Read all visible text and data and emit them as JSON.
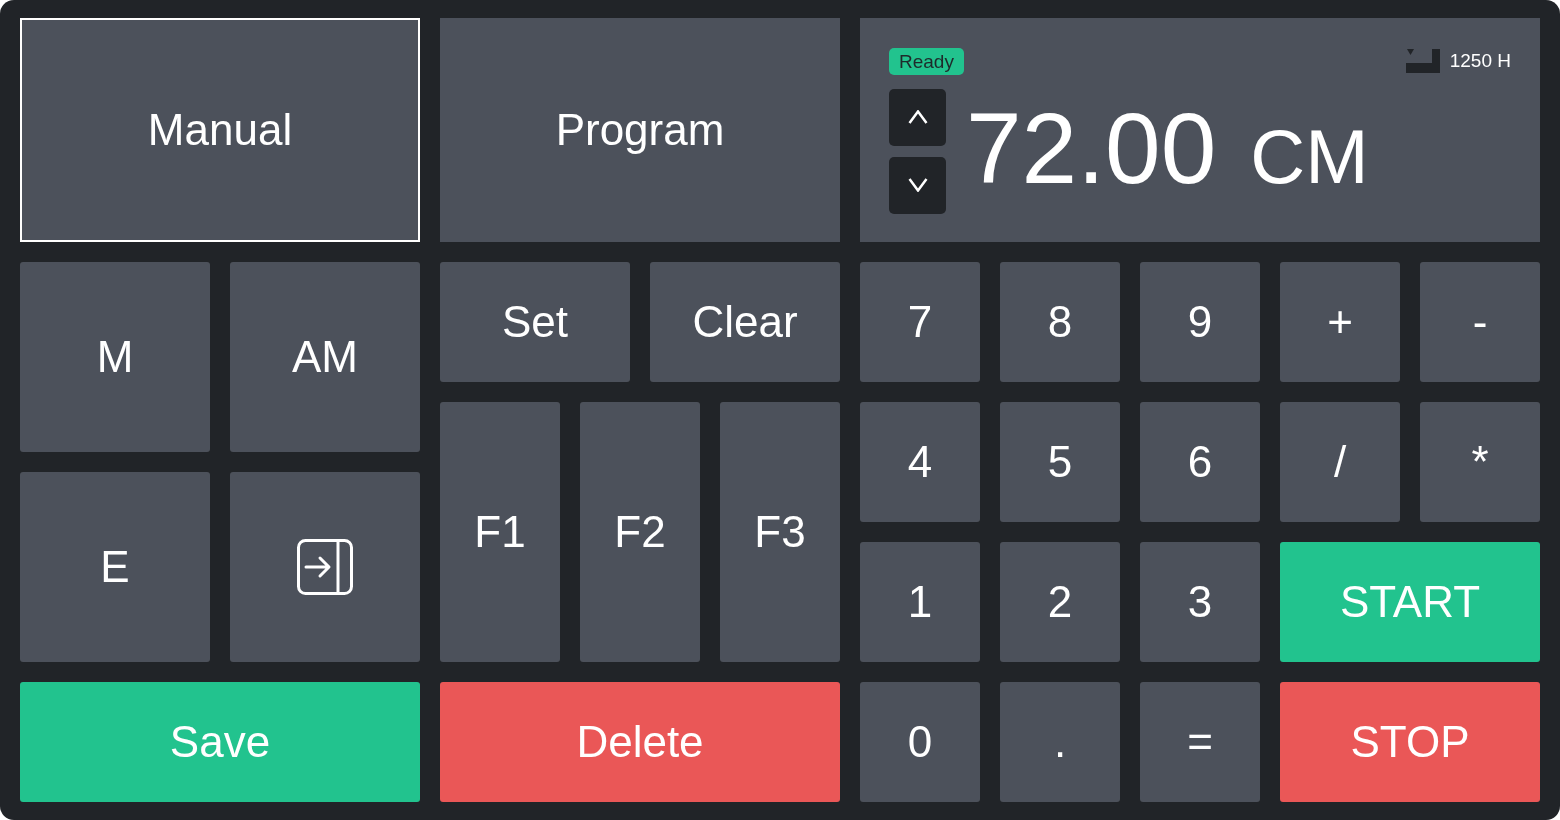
{
  "mode_tabs": [
    {
      "label": "Manual",
      "selected": true
    },
    {
      "label": "Program",
      "selected": false
    }
  ],
  "display": {
    "status": "Ready",
    "reading": "1250 H",
    "value": "72.00",
    "unit": "CM"
  },
  "left_pad": [
    {
      "kind": "key",
      "label": "M"
    },
    {
      "kind": "key",
      "label": "AM"
    },
    {
      "kind": "key",
      "label": "E"
    },
    {
      "kind": "icon"
    },
    {
      "kind": "confirm",
      "label": "Save"
    }
  ],
  "middle_pad": [
    {
      "kind": "key",
      "label": "Set"
    },
    {
      "kind": "key",
      "label": "Clear"
    },
    {
      "kind": "key",
      "label": "F1"
    },
    {
      "kind": "key",
      "label": "F2"
    },
    {
      "kind": "key",
      "label": "F3"
    },
    {
      "kind": "danger",
      "label": "Delete"
    }
  ],
  "keypad": [
    {
      "kind": "key",
      "label": "7"
    },
    {
      "kind": "key",
      "label": "8"
    },
    {
      "kind": "key",
      "label": "9"
    },
    {
      "kind": "key",
      "label": "+"
    },
    {
      "kind": "key",
      "label": "-"
    },
    {
      "kind": "key",
      "label": "4"
    },
    {
      "kind": "key",
      "label": "5"
    },
    {
      "kind": "key",
      "label": "6"
    },
    {
      "kind": "key",
      "label": "/"
    },
    {
      "kind": "key",
      "label": "*"
    },
    {
      "kind": "key",
      "label": "1"
    },
    {
      "kind": "key",
      "label": "2"
    },
    {
      "kind": "key",
      "label": "3"
    },
    {
      "kind": "confirm",
      "label": "START"
    },
    {
      "kind": "key",
      "label": "0"
    },
    {
      "kind": "key",
      "label": "."
    },
    {
      "kind": "key",
      "label": "="
    },
    {
      "kind": "danger",
      "label": "STOP"
    }
  ]
}
